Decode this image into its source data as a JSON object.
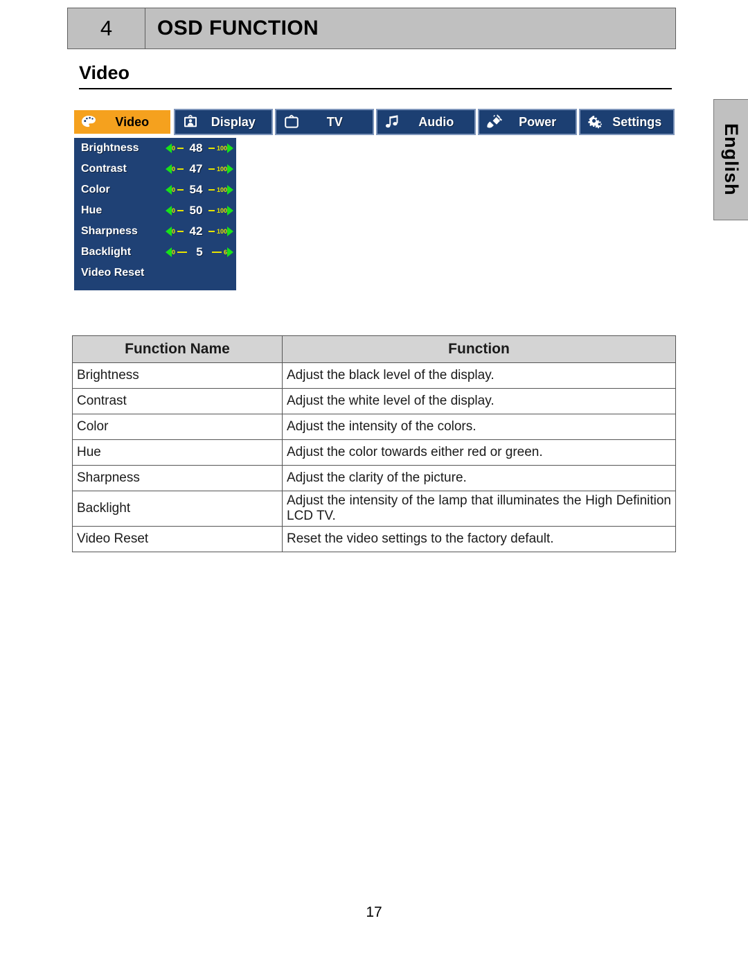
{
  "header": {
    "chapter_number": "4",
    "chapter_title": "OSD FUNCTION"
  },
  "section": {
    "heading": "Video"
  },
  "language_tab": {
    "label": "English"
  },
  "osd": {
    "tabs": [
      {
        "label": "Video",
        "icon": "palette-icon",
        "active": true
      },
      {
        "label": "Display",
        "icon": "monitor-icon",
        "active": false
      },
      {
        "label": "TV",
        "icon": "tv-icon",
        "active": false
      },
      {
        "label": "Audio",
        "icon": "music-note-icon",
        "active": false
      },
      {
        "label": "Power",
        "icon": "plug-icon",
        "active": false
      },
      {
        "label": "Settings",
        "icon": "gears-icon",
        "active": false
      }
    ],
    "menu_items": [
      {
        "label": "Brightness",
        "value": "48",
        "min": "0",
        "max": "100",
        "has_slider": true
      },
      {
        "label": "Contrast",
        "value": "47",
        "min": "0",
        "max": "100",
        "has_slider": true
      },
      {
        "label": "Color",
        "value": "54",
        "min": "0",
        "max": "100",
        "has_slider": true
      },
      {
        "label": "Hue",
        "value": "50",
        "min": "0",
        "max": "100",
        "has_slider": true
      },
      {
        "label": "Sharpness",
        "value": "42",
        "min": "0",
        "max": "100",
        "has_slider": true
      },
      {
        "label": "Backlight",
        "value": "5",
        "min": "0",
        "max": "6",
        "has_slider": true
      },
      {
        "label": "Video Reset",
        "value": "",
        "min": "",
        "max": "",
        "has_slider": false
      }
    ],
    "colors": {
      "active_tab": "#f5a11e",
      "tab_background": "#1c3f72",
      "panel_background": "#1f4175",
      "slider_arrow": "#18e218",
      "slider_track": "#e8e400"
    }
  },
  "table": {
    "headers": [
      "Function Name",
      "Function"
    ],
    "rows": [
      [
        "Brightness",
        "Adjust the black level of the display."
      ],
      [
        "Contrast",
        "Adjust the white level of the display."
      ],
      [
        "Color",
        "Adjust the intensity of the colors."
      ],
      [
        "Hue",
        "Adjust the color towards either red or green."
      ],
      [
        "Sharpness",
        "Adjust the clarity of the picture."
      ],
      [
        "Backlight",
        "Adjust the intensity of the lamp that illuminates the High Definition LCD TV."
      ],
      [
        "Video Reset",
        "Reset the video settings to the factory default."
      ]
    ]
  },
  "footer": {
    "page_number": "17"
  }
}
